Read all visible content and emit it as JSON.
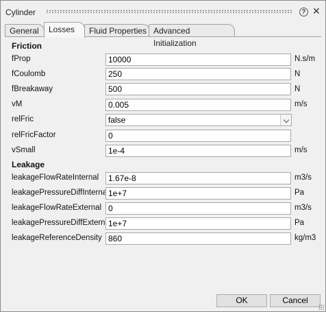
{
  "window": {
    "title": "Cylinder"
  },
  "tabs": [
    {
      "label": "General",
      "active": false
    },
    {
      "label": "Losses",
      "active": true
    },
    {
      "label": "Fluid Properties",
      "active": false
    },
    {
      "label": "Advanced Initialization",
      "active": false
    }
  ],
  "friction": {
    "heading": "Friction",
    "fProp": {
      "label": "fProp",
      "value": "10000",
      "unit": "N.s/m"
    },
    "fCoulomb": {
      "label": "fCoulomb",
      "value": "250",
      "unit": "N"
    },
    "fBreakaway": {
      "label": "fBreakaway",
      "value": "500",
      "unit": "N"
    },
    "vM": {
      "label": "vM",
      "value": "0.005",
      "unit": "m/s"
    },
    "relFric": {
      "label": "relFric",
      "value": "false"
    },
    "relFricFactor": {
      "label": "relFricFactor",
      "value": "0"
    },
    "vSmall": {
      "label": "vSmall",
      "value": "1e-4",
      "unit": "m/s"
    }
  },
  "leakage": {
    "heading": "Leakage",
    "flowRateInternal": {
      "label": "leakageFlowRateInternal",
      "value": "1.67e-8",
      "unit": "m3/s"
    },
    "pressureDiffInternal": {
      "label": "leakagePressureDiffInternal",
      "value": "1e+7",
      "unit": "Pa"
    },
    "flowRateExternal": {
      "label": "leakageFlowRateExternal",
      "value": "0",
      "unit": "m3/s"
    },
    "pressureDiffExternal": {
      "label": "leakagePressureDiffExternal",
      "value": "1e+7",
      "unit": "Pa"
    },
    "referenceDensity": {
      "label": "leakageReferenceDensity",
      "value": "860",
      "unit": "kg/m3"
    }
  },
  "buttons": {
    "ok": {
      "label": "OK"
    },
    "cancel": {
      "label": "Cancel"
    }
  },
  "icons": {
    "help": "help-icon",
    "close": "close-icon",
    "dropdown": "chevron-down-icon"
  }
}
